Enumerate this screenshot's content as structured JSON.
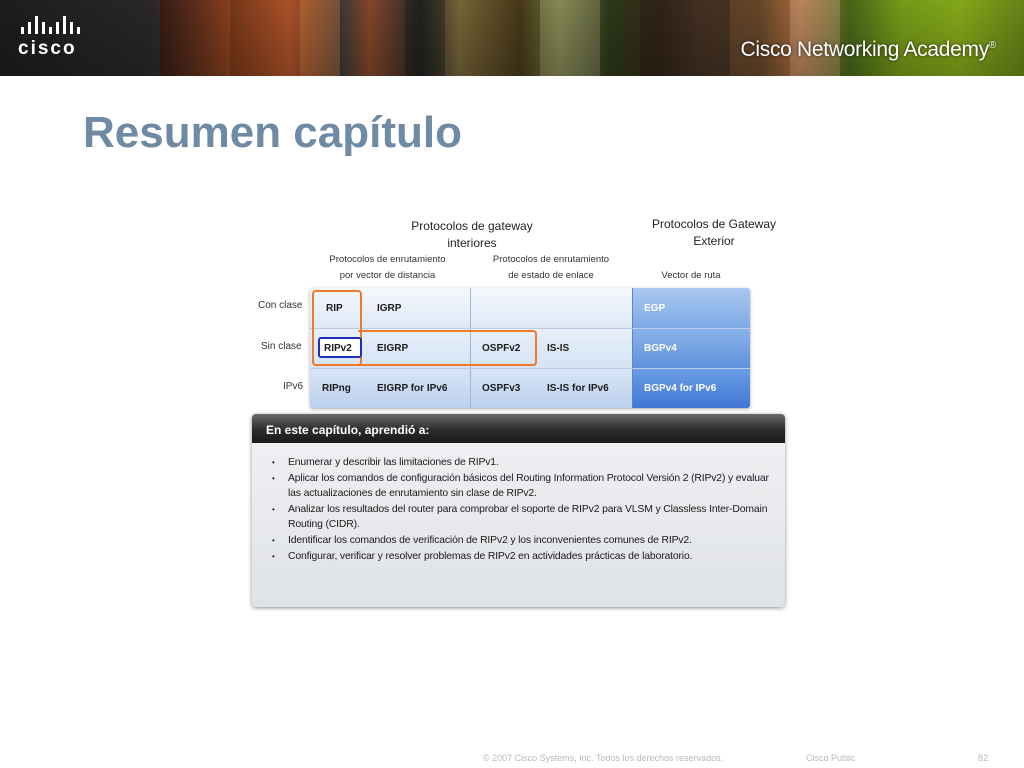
{
  "header": {
    "logo_text": "cisco",
    "academy_text": "Cisco Networking Academy",
    "academy_mark": "®"
  },
  "title": "Resumen capítulo",
  "table": {
    "interior_header": [
      "Protocolos de gateway",
      "interiores"
    ],
    "exterior_header": [
      "Protocolos de Gateway",
      "Exterior"
    ],
    "sub_headers": {
      "distance_vector": [
        "Protocolos de enrutamiento",
        "por vector de distancia"
      ],
      "link_state": [
        "Protocolos de enrutamiento",
        "de estado de enlace"
      ],
      "path_vector": "Vector de ruta"
    },
    "row_labels": [
      "Con clase",
      "Sin clase",
      "IPv6"
    ],
    "rows": [
      {
        "dv1": "RIP",
        "dv2": "IGRP",
        "ls1": "",
        "ls2": "",
        "pv": "EGP"
      },
      {
        "dv1": "RIPv2",
        "dv2": "EIGRP",
        "ls1": "OSPFv2",
        "ls2": "IS-IS",
        "pv": "BGPv4"
      },
      {
        "dv1": "RIPng",
        "dv2": "EIGRP for IPv6",
        "ls1": "OSPFv3",
        "ls2": "IS-IS for IPv6",
        "pv": "BGPv4 for IPv6"
      }
    ],
    "highlight_colors": {
      "orange": "#ee7a2a",
      "blue": "#1f2fb5"
    }
  },
  "summary": {
    "heading": "En este capítulo, aprendió a:",
    "items": [
      "Enumerar y describir las limitaciones de RIPv1.",
      "Aplicar los comandos de configuración básicos del Routing Information Protocol Versión 2 (RIPv2) y evaluar las actualizaciones de enrutamiento sin clase de RIPv2.",
      "Analizar los resultados del router para comprobar el soporte de RIPv2 para VLSM y Classless Inter-Domain Routing (CIDR).",
      "Identificar los comandos de verificación de RIPv2 y los inconvenientes comunes de RIPv2.",
      "Configurar, verificar y resolver problemas de RIPv2 en actividades prácticas de laboratorio."
    ]
  },
  "footer": {
    "copyright": "© 2007 Cisco Systems, Inc. Todos los derechos reservados.",
    "classification": "Cisco Public",
    "page_number": "82"
  },
  "colors": {
    "title": "#6f8aa3",
    "accent_orange": "#ee7a2a",
    "accent_blue": "#1f2fb5",
    "path_vector_blue": "#5f92dc"
  }
}
